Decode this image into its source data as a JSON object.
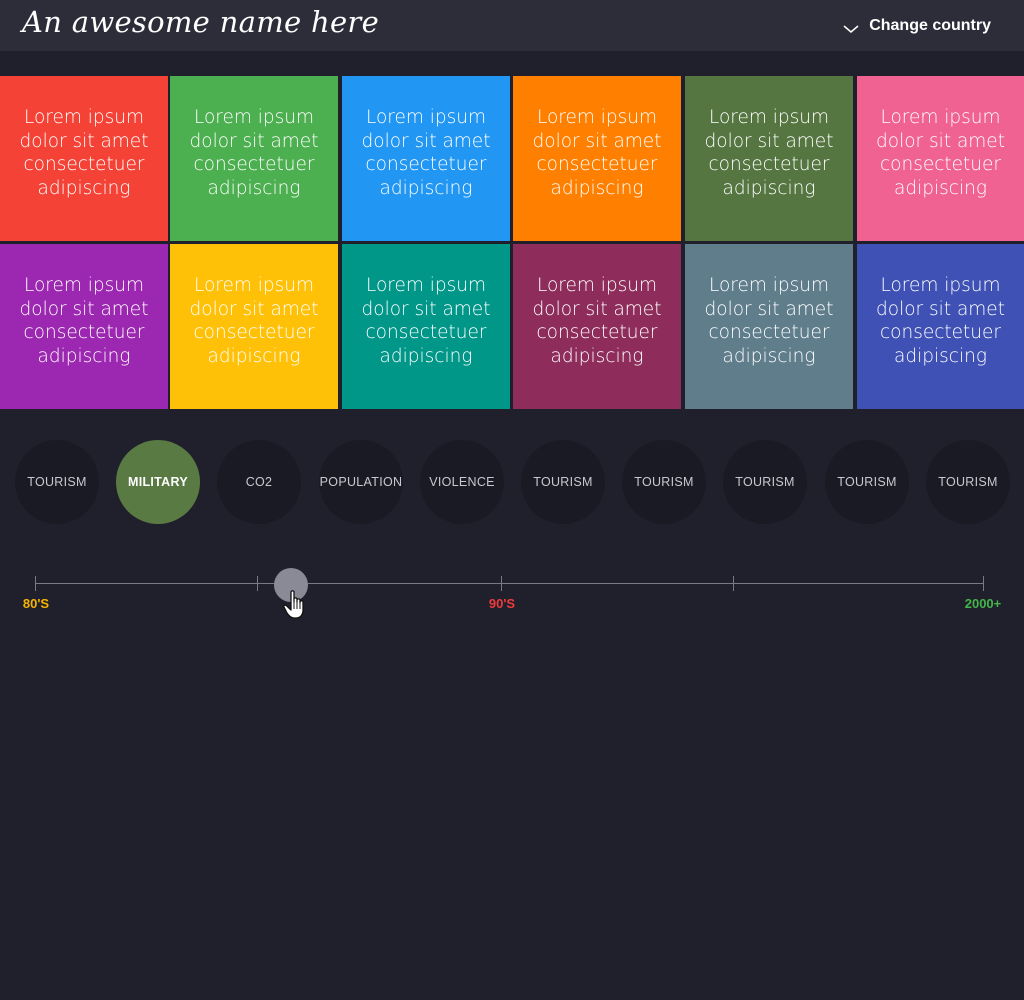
{
  "header": {
    "title": "An awesome name here",
    "country_label": "Change country",
    "chevron_icon": "chevron-down-icon"
  },
  "tiles": [
    {
      "text": "Lorem ipsum dolor sit amet consectetuer adipiscing",
      "color": "#f44336"
    },
    {
      "text": "Lorem ipsum dolor sit amet consectetuer adipiscing",
      "color": "#4caf50"
    },
    {
      "text": "Lorem ipsum dolor sit amet consectetuer adipiscing",
      "color": "#2196f3"
    },
    {
      "text": "Lorem ipsum dolor sit amet consectetuer adipiscing",
      "color": "#ff8000"
    },
    {
      "text": "Lorem ipsum dolor sit amet consectetuer adipiscing",
      "color": "#557541"
    },
    {
      "text": "Lorem ipsum dolor sit amet consectetuer adipiscing",
      "color": "#f06292"
    },
    {
      "text": "Lorem ipsum dolor sit amet consectetuer adipiscing",
      "color": "#9c27b0"
    },
    {
      "text": "Lorem ipsum dolor sit amet consectetuer adipiscing",
      "color": "#ffc107"
    },
    {
      "text": "Lorem ipsum dolor sit amet consectetuer adipiscing",
      "color": "#009688"
    },
    {
      "text": "Lorem ipsum dolor sit amet consectetuer adipiscing",
      "color": "#8e2d5b"
    },
    {
      "text": "Lorem ipsum dolor sit amet consectetuer adipiscing",
      "color": "#607d8b"
    },
    {
      "text": "Lorem ipsum dolor sit amet consectetuer adipiscing",
      "color": "#3f51b5"
    }
  ],
  "categories": [
    {
      "label": "TOURISM",
      "active": false
    },
    {
      "label": "MILITARY",
      "active": true
    },
    {
      "label": "CO2",
      "active": false
    },
    {
      "label": "POPULATION",
      "active": false
    },
    {
      "label": "VIOLENCE",
      "active": false
    },
    {
      "label": "TOURISM",
      "active": false
    },
    {
      "label": "TOURISM",
      "active": false
    },
    {
      "label": "TOURISM",
      "active": false
    },
    {
      "label": "TOURISM",
      "active": false
    },
    {
      "label": "TOURISM",
      "active": false
    }
  ],
  "colors": {
    "active_category": "#5a7a44",
    "label_80s": "#f5b400",
    "label_90s": "#ef3b3b",
    "label_2000s": "#43b549"
  },
  "timeline": {
    "labels": [
      "80'S",
      "90'S",
      "2000+"
    ],
    "handle_fraction": 0.27,
    "cursor_icon": "hand-pointer-icon"
  }
}
